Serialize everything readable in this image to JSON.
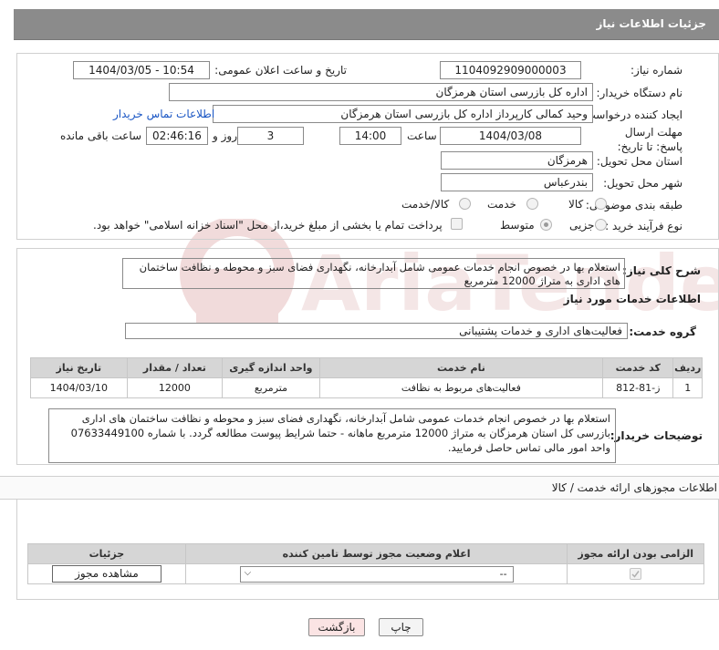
{
  "header": {
    "title": "جزئیات اطلاعات نیاز"
  },
  "form": {
    "need_number_label": "شماره نیاز:",
    "need_number": "1104092909000003",
    "announce_label": "تاریخ و ساعت اعلان عمومی:",
    "announce_value": "1404/03/05 - 10:54",
    "buyer_org_label": "نام دستگاه خریدار:",
    "buyer_org": "اداره کل بازرسی استان هرمزگان",
    "creator_label": "ایجاد کننده درخواست:",
    "creator": "وحید  کمالی کارپرداز اداره کل بازرسی استان هرمزگان",
    "buyer_contact_link": "اطلاعات تماس خریدار",
    "deadline_label": "مهلت ارسال پاسخ: تا تاریخ:",
    "deadline_date": "1404/03/08",
    "hour_label": "ساعت",
    "deadline_time": "14:00",
    "days_value": "3",
    "days_label": "روز و",
    "remaining_time": "02:46:16",
    "remaining_label": "ساعت باقی مانده",
    "province_label": "استان محل تحویل:",
    "province": "هرمزگان",
    "city_label": "شهر محل تحویل:",
    "city": "بندرعباس",
    "category_label": "طبقه بندی موضوعی:",
    "category_options": [
      "کالا",
      "خدمت",
      "کالا/خدمت"
    ],
    "purchase_type_label": "نوع فرآیند خرید :",
    "purchase_type_options": [
      "جزیی",
      "متوسط"
    ],
    "payment_note": "پرداخت تمام یا بخشی از مبلغ خرید،از محل \"اسناد خزانه اسلامی\" خواهد بود."
  },
  "summary": {
    "label": "شرح کلی نیاز:",
    "text": "استعلام بها در خصوص انجام خدمات عمومی شامل آبدارخانه، نگهداری فضای سبز و محوطه و نظافت ساختمان های اداری به متراژ 12000 مترمربع"
  },
  "services": {
    "section_title": "اطلاعات خدمات مورد نیاز",
    "group_label": "گروه خدمت:",
    "group_value": "فعالیت‌های اداری و خدمات پشتیبانی",
    "columns": [
      "ردیف",
      "کد خدمت",
      "نام خدمت",
      "واحد اندازه گیری",
      "تعداد / مقدار",
      "تاریخ نیاز"
    ],
    "rows": [
      [
        "1",
        "ز-81-812",
        "فعالیت‌های مربوط به نظافت",
        "مترمربع",
        "12000",
        "1404/03/10"
      ]
    ]
  },
  "buyer_notes": {
    "label": "توضیحات خریدار:",
    "text": "استعلام بها در خصوص انجام خدمات عمومی شامل آبدارخانه، نگهداری فضای سبز و محوطه و نظافت ساختمان های اداری بازرسی کل استان هرمزگان به متراژ 12000 مترمربع ماهانه - حتما شرایط پیوست مطالعه گردد. با شماره 07633449100 واحد امور مالی تماس حاصل فرمایید."
  },
  "permits": {
    "section_title": "اطلاعات مجوزهای ارائه خدمت / کالا",
    "columns": [
      "الزامی بودن ارائه مجوز",
      "اعلام وضعیت مجوز توسط تامین کننده",
      "جزئیات"
    ],
    "status_select": "--",
    "view_button": "مشاهده مجوز"
  },
  "footer": {
    "print_button": "چاپ",
    "back_button": "بازگشت"
  },
  "watermark": "AriaTender.net",
  "colors": {
    "header_bg": "#8b8b8b",
    "link": "#1a56c4",
    "watermark": "#e2b1b1",
    "back_button_bg": "#fbe4e4"
  }
}
